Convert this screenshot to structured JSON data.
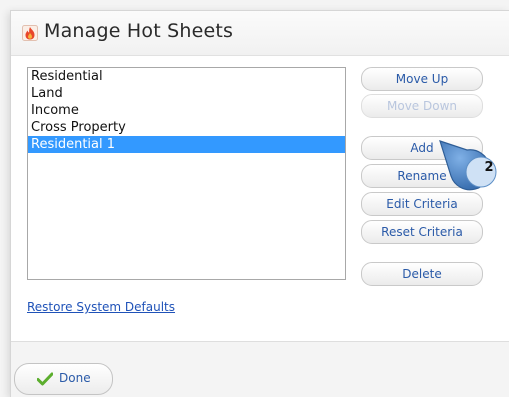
{
  "dialog": {
    "title": "Manage Hot Sheets",
    "icon": "flame-icon"
  },
  "list": {
    "items": [
      {
        "label": "Residential",
        "selected": false
      },
      {
        "label": "Land",
        "selected": false
      },
      {
        "label": "Income",
        "selected": false
      },
      {
        "label": "Cross Property",
        "selected": false
      },
      {
        "label": "Residential 1",
        "selected": true
      }
    ]
  },
  "buttons": {
    "move_up": "Move Up",
    "move_down": "Move Down",
    "add": "Add",
    "rename": "Rename",
    "edit_criteria": "Edit Criteria",
    "reset_criteria": "Reset Criteria",
    "delete": "Delete"
  },
  "restore_link": "Restore System Defaults",
  "footer": {
    "done": "Done",
    "done_icon": "checkmark-icon"
  },
  "callout": {
    "number": "2"
  },
  "colors": {
    "selection": "#3399ff",
    "button_text": "#2a5aa8",
    "link": "#1f52b8",
    "callout": "#4a82c4"
  }
}
